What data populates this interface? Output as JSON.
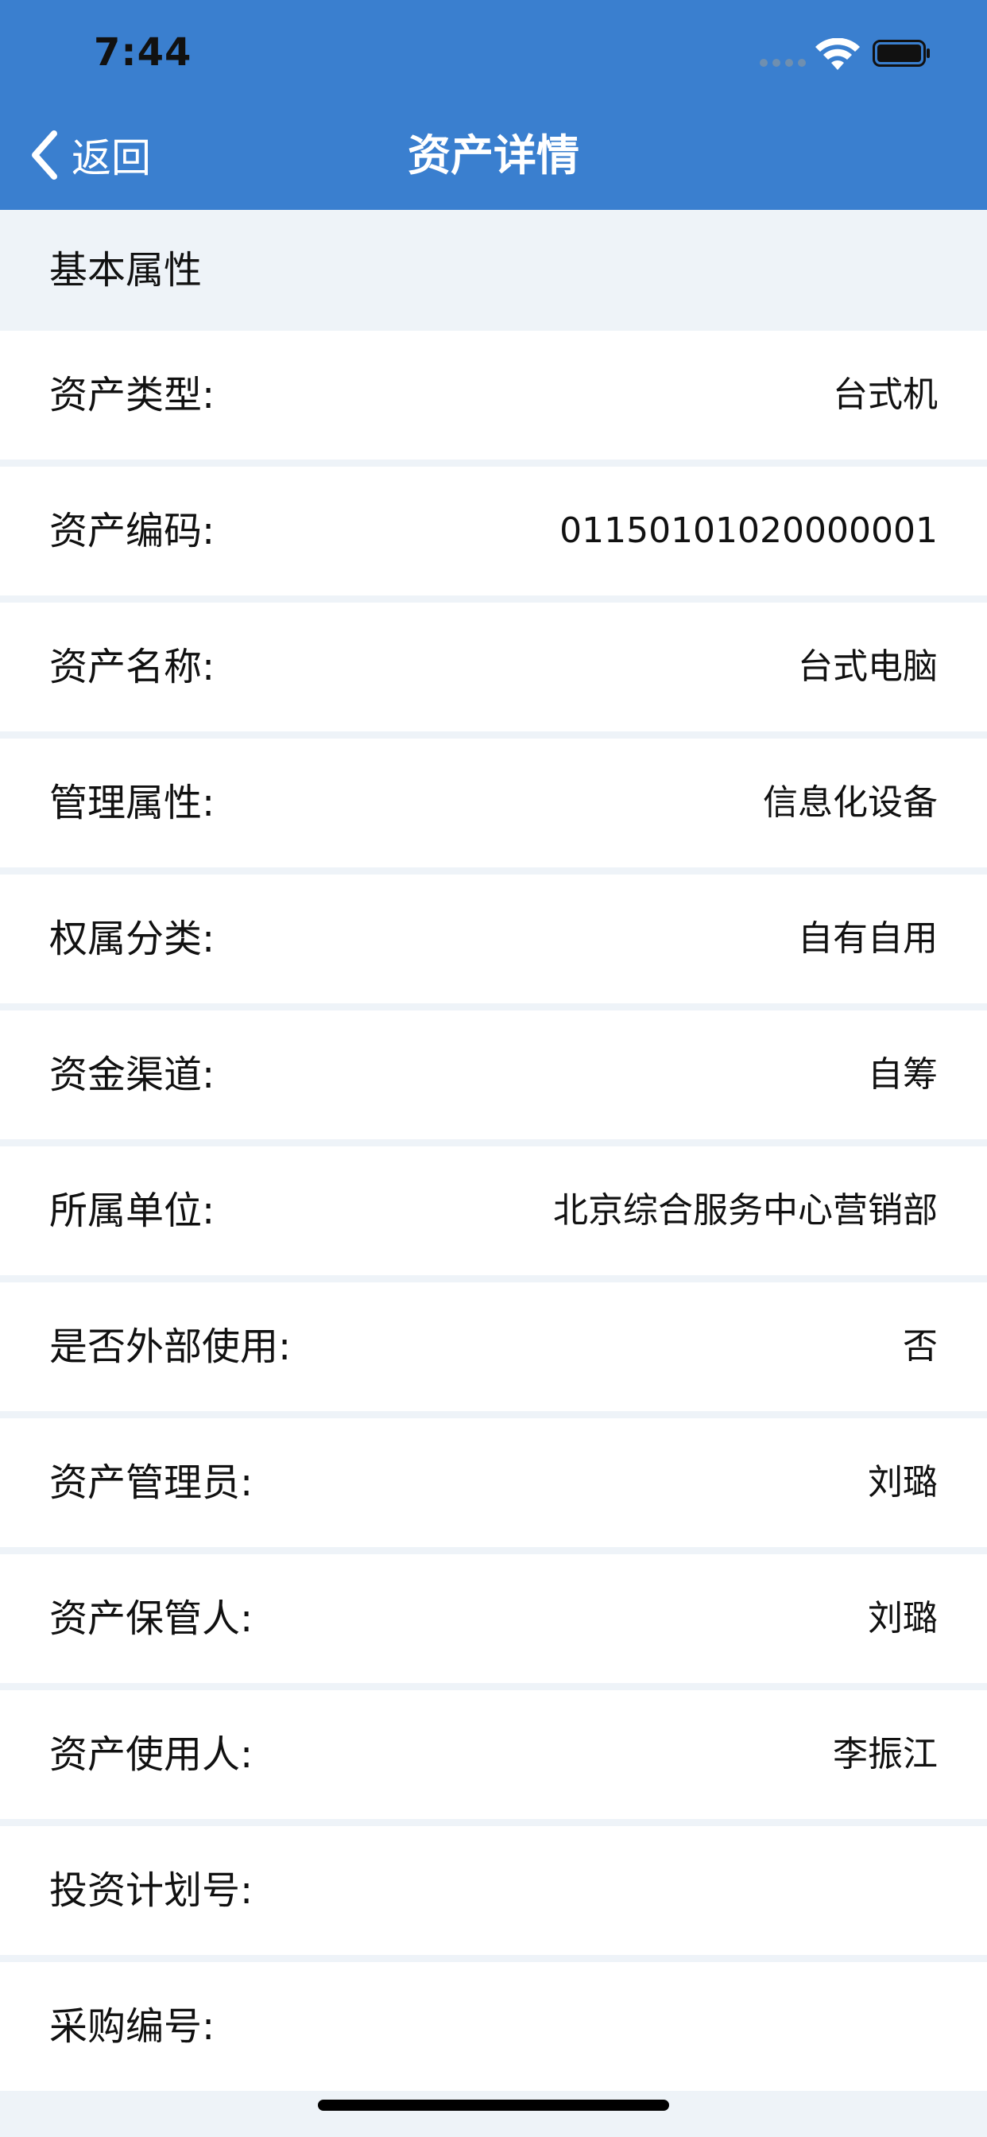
{
  "status_bar": {
    "time": "7:44"
  },
  "nav": {
    "back_label": "返回",
    "title": "资产详情"
  },
  "section": {
    "title": "基本属性"
  },
  "rows": [
    {
      "label": "资产类型:",
      "value": "台式机"
    },
    {
      "label": "资产编码:",
      "value": "01150101020000001"
    },
    {
      "label": "资产名称:",
      "value": "台式电脑"
    },
    {
      "label": "管理属性:",
      "value": "信息化设备"
    },
    {
      "label": "权属分类:",
      "value": "自有自用"
    },
    {
      "label": "资金渠道:",
      "value": "自筹"
    },
    {
      "label": "所属单位:",
      "value": "北京综合服务中心营销部"
    },
    {
      "label": "是否外部使用:",
      "value": "否"
    },
    {
      "label": "资产管理员:",
      "value": "刘璐"
    },
    {
      "label": "资产保管人:",
      "value": "刘璐"
    },
    {
      "label": "资产使用人:",
      "value": "李振江"
    },
    {
      "label": "投资计划号:",
      "value": ""
    },
    {
      "label": "采购编号:",
      "value": ""
    }
  ],
  "colors": {
    "header": "#3a7fcf",
    "background": "#eef3f8",
    "row": "#ffffff",
    "text": "#111111"
  },
  "icons": {
    "back": "chevron-left-icon",
    "wifi": "wifi-icon",
    "battery": "battery-icon",
    "signal": "signal-icon"
  }
}
